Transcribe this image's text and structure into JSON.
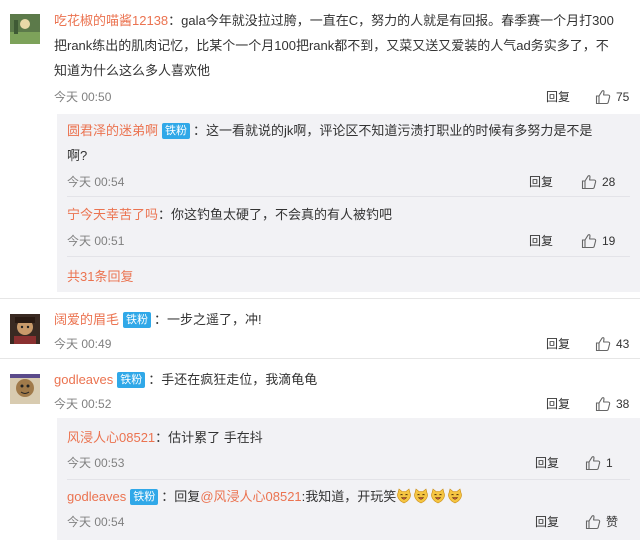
{
  "comments": [
    {
      "username": "吃花椒的喵酱12138",
      "line1": "gala今年就没拉过胯，一直在C，努力的人就是有回报。春季赛一个月打300",
      "line2": "把rank练出的肌肉记忆，比某个一个月100把rank都不到，又菜又送又爱装的人气ad务实多了，不",
      "line3": "知道为什么这么多人喜欢他",
      "time": "今天 00:50",
      "reply_label": "回复",
      "likes": "75"
    },
    {
      "username": "阔爱的眉毛",
      "badge": "铁粉",
      "text": "一步之遥了，冲!",
      "time": "今天 00:49",
      "reply_label": "回复",
      "likes": "43"
    },
    {
      "username": "godleaves",
      "badge": "铁粉",
      "text": "手还在疯狂走位，我滴龟龟",
      "time": "今天 00:52",
      "reply_label": "回复",
      "likes": "38"
    }
  ],
  "replies_1": [
    {
      "username": "圆君泽的迷弟啊",
      "badge": "铁粉",
      "line1": "这一看就说的jk啊，评论区不知道污渍打职业的时候有多努力是不是",
      "line2": "啊?",
      "time": "今天 00:54",
      "reply_label": "回复",
      "likes": "28"
    },
    {
      "username": "宁今天幸苦了吗",
      "text": "你这钓鱼太硬了，不会真的有人被钓吧",
      "time": "今天 00:51",
      "reply_label": "回复",
      "likes": "19"
    }
  ],
  "more_replies_label": "共31条回复",
  "replies_3": [
    {
      "username": "风浸人心08521",
      "text": "估计累了 手在抖",
      "time": "今天 00:53",
      "reply_label": "回复",
      "likes": "1"
    },
    {
      "username": "godleaves",
      "badge": "铁粉",
      "reply_prefix": "回复",
      "mention": "@风浸人心08521",
      "text": ":我知道，开玩笑",
      "emoji_count": 4,
      "time": "今天 00:54",
      "reply_label": "回复",
      "likes": "赞"
    }
  ],
  "colors": {
    "username": "#eb7350",
    "badge": "#30a8e8",
    "reply_background": "#f2f2f5",
    "meta": "#808080"
  },
  "icons": [
    "thumbs-up-icon",
    "laughing-face-icon"
  ]
}
